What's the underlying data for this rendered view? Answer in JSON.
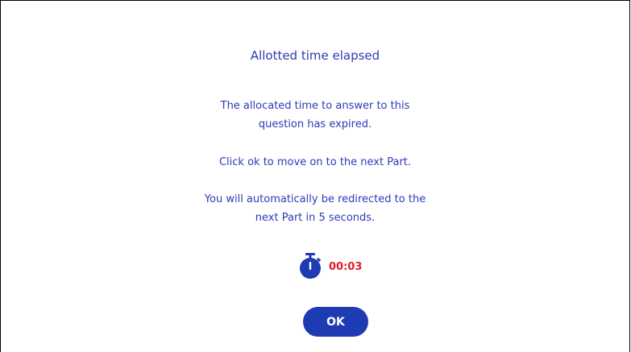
{
  "dialog": {
    "title": "Allotted time elapsed",
    "message_1_line_1": "The allocated time to answer to this",
    "message_1_line_2": "question has expired.",
    "message_2": "Click ok to move on to the next Part.",
    "message_3_line_1": "You will automatically be redirected to the",
    "message_3_line_2": "next Part in 5 seconds.",
    "timer": {
      "icon": "stopwatch-icon",
      "value": "00:03"
    },
    "ok_label": "OK"
  },
  "colors": {
    "text": "#2b3bb5",
    "accent": "#1f3bb3",
    "timer_text": "#e01b2a"
  }
}
